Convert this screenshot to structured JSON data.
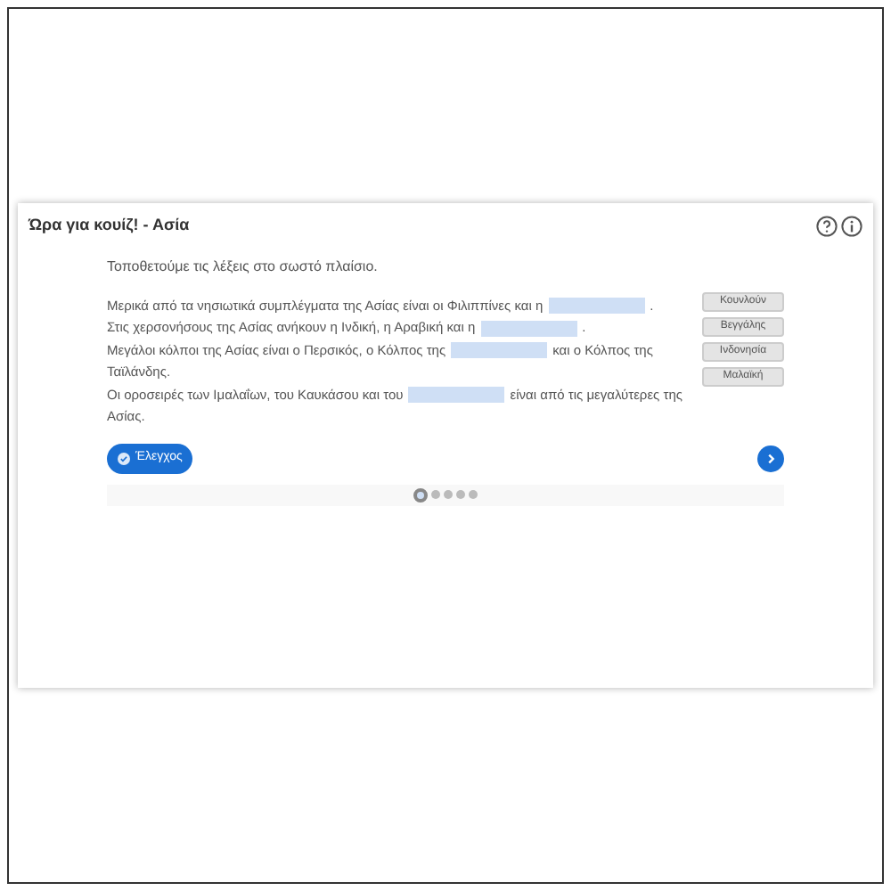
{
  "card": {
    "title": "Ώρα για κουίζ! - Ασία",
    "instruction": "Τοποθετούμε τις λέξεις στο σωστό πλαίσιο.",
    "lines": [
      [
        {
          "kind": "text",
          "text": "Μερικά από τα νησιωτικά συμπλέγματα της Ασίας είναι οι Φιλιππίνες και η"
        },
        {
          "kind": "blank"
        },
        {
          "kind": "text",
          "text": "."
        }
      ],
      [
        {
          "kind": "text",
          "text": "Στις χερσονήσους της Ασίας ανήκουν η Ινδική, η Αραβική και η"
        },
        {
          "kind": "blank"
        },
        {
          "kind": "text",
          "text": "."
        }
      ],
      [
        {
          "kind": "text",
          "text": "Μεγάλοι κόλποι της Ασίας είναι ο Περσικός, ο Κόλπος της"
        },
        {
          "kind": "blank"
        },
        {
          "kind": "text",
          "text": "και ο Κόλπος της"
        }
      ],
      [
        {
          "kind": "text",
          "text": "Ταϊλάνδης."
        }
      ],
      [
        {
          "kind": "text",
          "text": "Οι οροσειρές των Ιμαλαΐων, του Καυκάσου και του"
        },
        {
          "kind": "blank"
        },
        {
          "kind": "text",
          "text": "είναι από τις μεγαλύτερες της"
        }
      ],
      [
        {
          "kind": "text",
          "text": "Ασίας."
        }
      ]
    ],
    "words": [
      "Κουνλούν",
      "Βεγγάλης",
      "Ινδονησία",
      "Μαλαϊκή"
    ],
    "check_button": "Έλεγχος",
    "pages": [
      {
        "selected": true
      },
      {
        "selected": false
      },
      {
        "selected": false
      },
      {
        "selected": false
      },
      {
        "selected": false
      }
    ]
  }
}
